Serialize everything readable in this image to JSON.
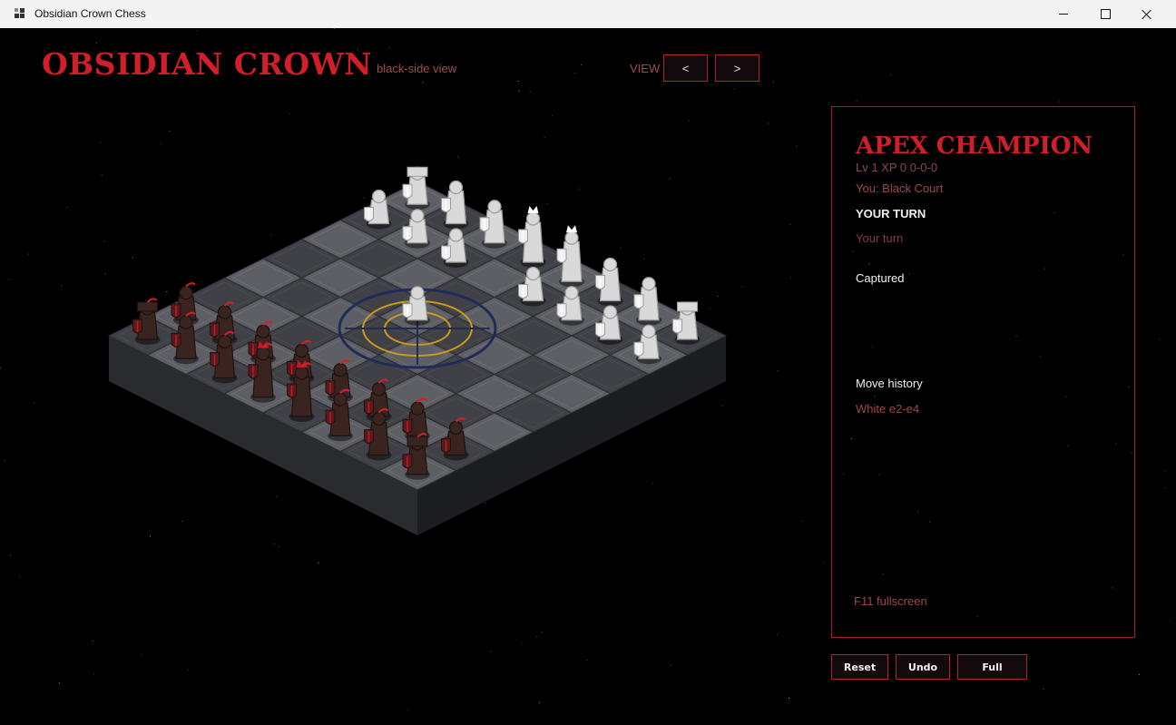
{
  "window": {
    "title": "Obsidian Crown Chess"
  },
  "header": {
    "title": "OBSIDIAN CROWN",
    "view_mode": "black-side view",
    "view_label": "VIEW",
    "prev_label": "<",
    "next_label": ">"
  },
  "board": {
    "white_pieces": "white-knight-pieces",
    "black_pieces": "crimson-knight-pieces",
    "selection": "target-reticle-icon",
    "last_move": "e2-e4"
  },
  "panel": {
    "champion_title": "APEX CHAMPION",
    "stats": "Lv 1  XP 0  0-0-0",
    "side": "You: Black Court",
    "turn_heading": "YOUR TURN",
    "turn_status": "Your turn",
    "captured_heading": "Captured",
    "history_heading": "Move history",
    "history": [
      "White e2-e4"
    ],
    "hint": "F11 fullscreen"
  },
  "actions": {
    "reset": "Reset",
    "undo": "Undo",
    "full": "Full"
  },
  "colors": {
    "accent_red": "#d11f2a",
    "muted_red": "#9c474c",
    "background": "#000000"
  }
}
